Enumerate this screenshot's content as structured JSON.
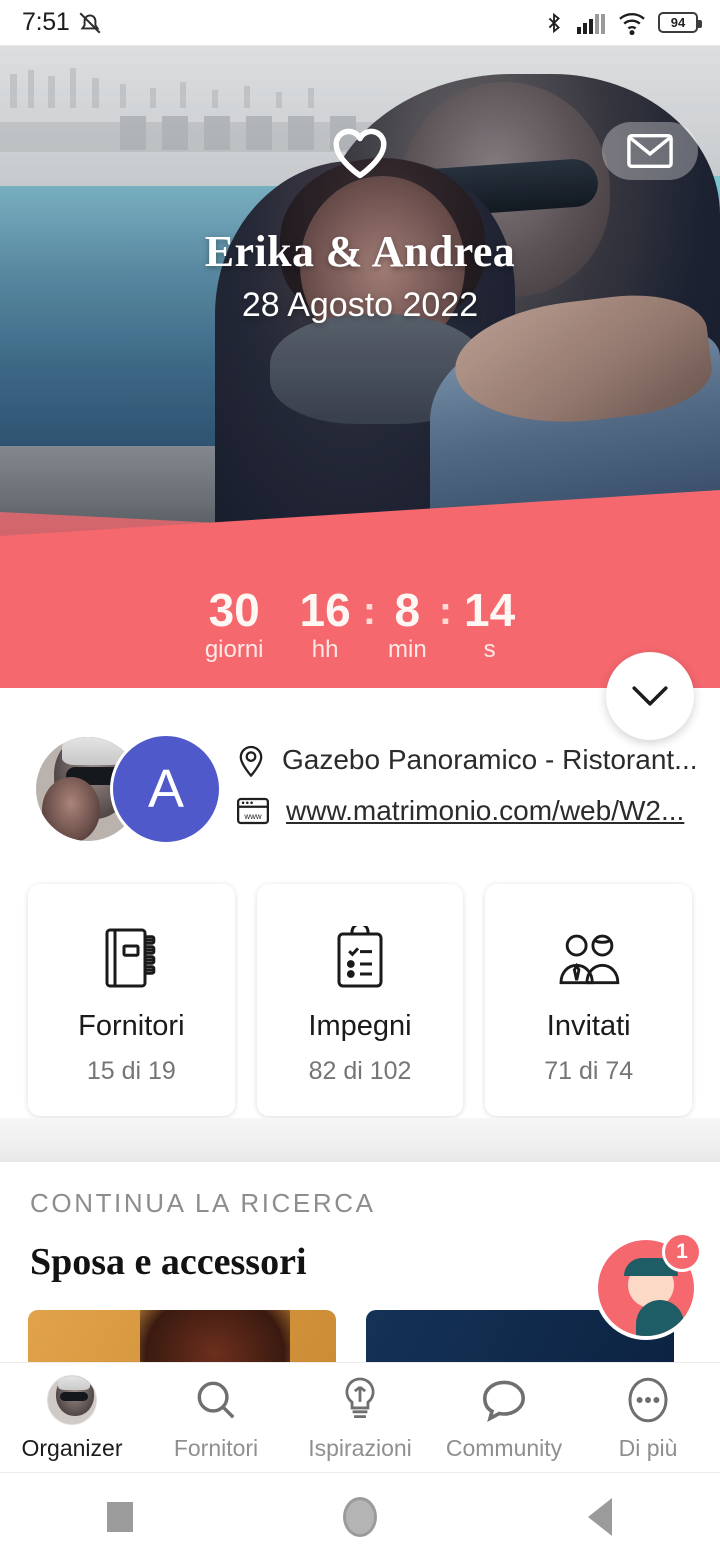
{
  "status_bar": {
    "time": "7:51",
    "battery_level": "94",
    "icons": [
      "vibrate-off-icon",
      "bluetooth-icon",
      "cellular-signal-icon",
      "wifi-icon",
      "battery-icon"
    ]
  },
  "hero": {
    "couple_names": "Erika & Andrea",
    "wedding_date": "28 Agosto 2022",
    "favorite_icon": "heart-icon",
    "mail_icon": "envelope-icon"
  },
  "countdown": {
    "days_value": "30",
    "days_label": "giorni",
    "hours_value": "16",
    "hours_label": "hh",
    "minutes_value": "8",
    "minutes_label": "min",
    "seconds_value": "14",
    "seconds_label": "s",
    "separator": ":",
    "expand_icon": "chevron-down-icon",
    "background_color": "#F4686E"
  },
  "info": {
    "avatar_letter": "A",
    "avatar_color": "#5059C9",
    "location_icon": "map-pin-icon",
    "location": "Gazebo Panoramico - Ristorant...",
    "website_icon": "browser-window-icon",
    "website": "www.matrimonio.com/web/W2..."
  },
  "stat_cards": [
    {
      "icon": "notebook-icon",
      "title": "Fornitori",
      "subtitle": "15 di 19"
    },
    {
      "icon": "clipboard-checklist-icon",
      "title": "Impegni",
      "subtitle": "82 di 102"
    },
    {
      "icon": "guests-couple-icon",
      "title": "Invitati",
      "subtitle": "71 di 74"
    }
  ],
  "section": {
    "kicker": "CONTINUA LA RICERCA",
    "title": "Sposa e accessori"
  },
  "assistant": {
    "badge_count": "1",
    "icon": "assistant-avatar-icon"
  },
  "bottom_nav": [
    {
      "icon": "profile-avatar-icon",
      "label": "Organizer",
      "active": true
    },
    {
      "icon": "search-icon",
      "label": "Fornitori",
      "active": false
    },
    {
      "icon": "lightbulb-icon",
      "label": "Ispirazioni",
      "active": false
    },
    {
      "icon": "speech-bubble-icon",
      "label": "Community",
      "active": false
    },
    {
      "icon": "more-dots-icon",
      "label": "Di più",
      "active": false
    }
  ],
  "android_nav": [
    {
      "icon": "recents-square-icon"
    },
    {
      "icon": "home-circle-icon"
    },
    {
      "icon": "back-triangle-icon"
    }
  ]
}
